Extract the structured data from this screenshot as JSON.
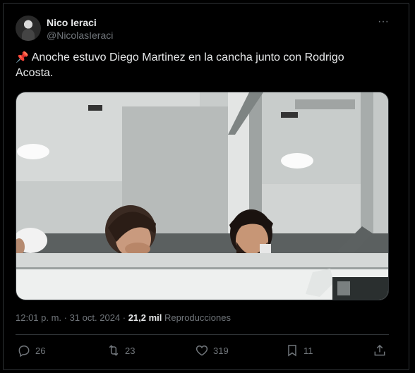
{
  "user": {
    "name": "Nico Ieraci",
    "handle": "@NicolasIeraci"
  },
  "tweet": {
    "pin_icon": "📌",
    "text": "Anoche estuvo Diego Martinez en la cancha junto con Rodrigo Acosta."
  },
  "meta": {
    "time_date": "12:01 p. m. · 31 oct. 2024 · ",
    "views_count": "21,2 mil",
    "views_label": " Reproducciones"
  },
  "actions": {
    "replies": "26",
    "retweets": "23",
    "likes": "319",
    "bookmarks": "11"
  },
  "icons": {
    "more": "more-icon",
    "reply": "reply-icon",
    "retweet": "retweet-icon",
    "like": "heart-icon",
    "bookmark": "bookmark-icon",
    "share": "share-icon"
  },
  "colors": {
    "background": "#000000",
    "text": "#e7e9ea",
    "secondary": "#71767b",
    "border": "#2f3336"
  }
}
